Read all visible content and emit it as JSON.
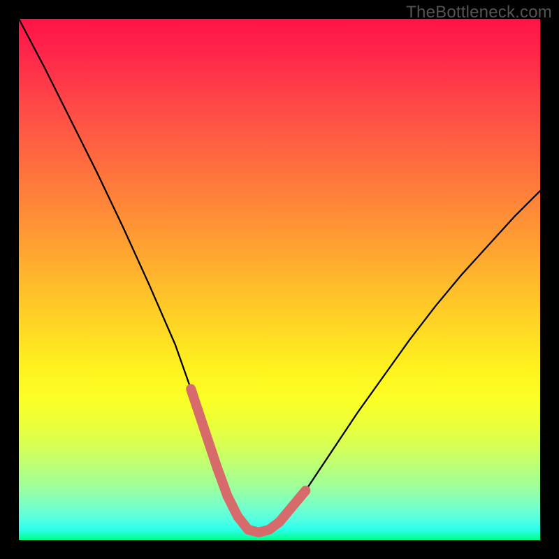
{
  "watermark": "TheBottleneck.com",
  "chart_data": {
    "type": "line",
    "title": "",
    "xlabel": "",
    "ylabel": "",
    "xlim": [
      0,
      100
    ],
    "ylim": [
      0,
      100
    ],
    "grid": false,
    "legend": false,
    "x": [
      0,
      5,
      10,
      15,
      20,
      25,
      30,
      33,
      36,
      38,
      40,
      42,
      44,
      46,
      48,
      50,
      55,
      60,
      65,
      70,
      75,
      80,
      85,
      90,
      95,
      100
    ],
    "series": [
      {
        "name": "bottleneck-curve",
        "values": [
          100,
          90.5,
          80.5,
          70.5,
          60.0,
          49.0,
          37.5,
          29.0,
          20.0,
          14.0,
          8.5,
          4.5,
          2.0,
          1.5,
          2.0,
          3.5,
          9.5,
          17.0,
          24.5,
          31.5,
          38.5,
          45.0,
          51.0,
          56.5,
          62.0,
          67.0
        ]
      },
      {
        "name": "highlight-band",
        "values": [
          null,
          null,
          null,
          null,
          null,
          null,
          null,
          29.0,
          20.0,
          14.0,
          8.5,
          4.5,
          2.0,
          1.5,
          2.0,
          3.5,
          9.5,
          null,
          null,
          null,
          null,
          null,
          null,
          null,
          null,
          null
        ]
      }
    ],
    "annotations": [
      {
        "text": "TheBottleneck.com",
        "position": "top-right"
      }
    ]
  },
  "colors": {
    "curve": "#000000",
    "highlight": "#d76a6a",
    "background_top": "#ff1347",
    "background_bottom": "#00ff88",
    "frame": "#000000",
    "watermark": "#545454"
  }
}
